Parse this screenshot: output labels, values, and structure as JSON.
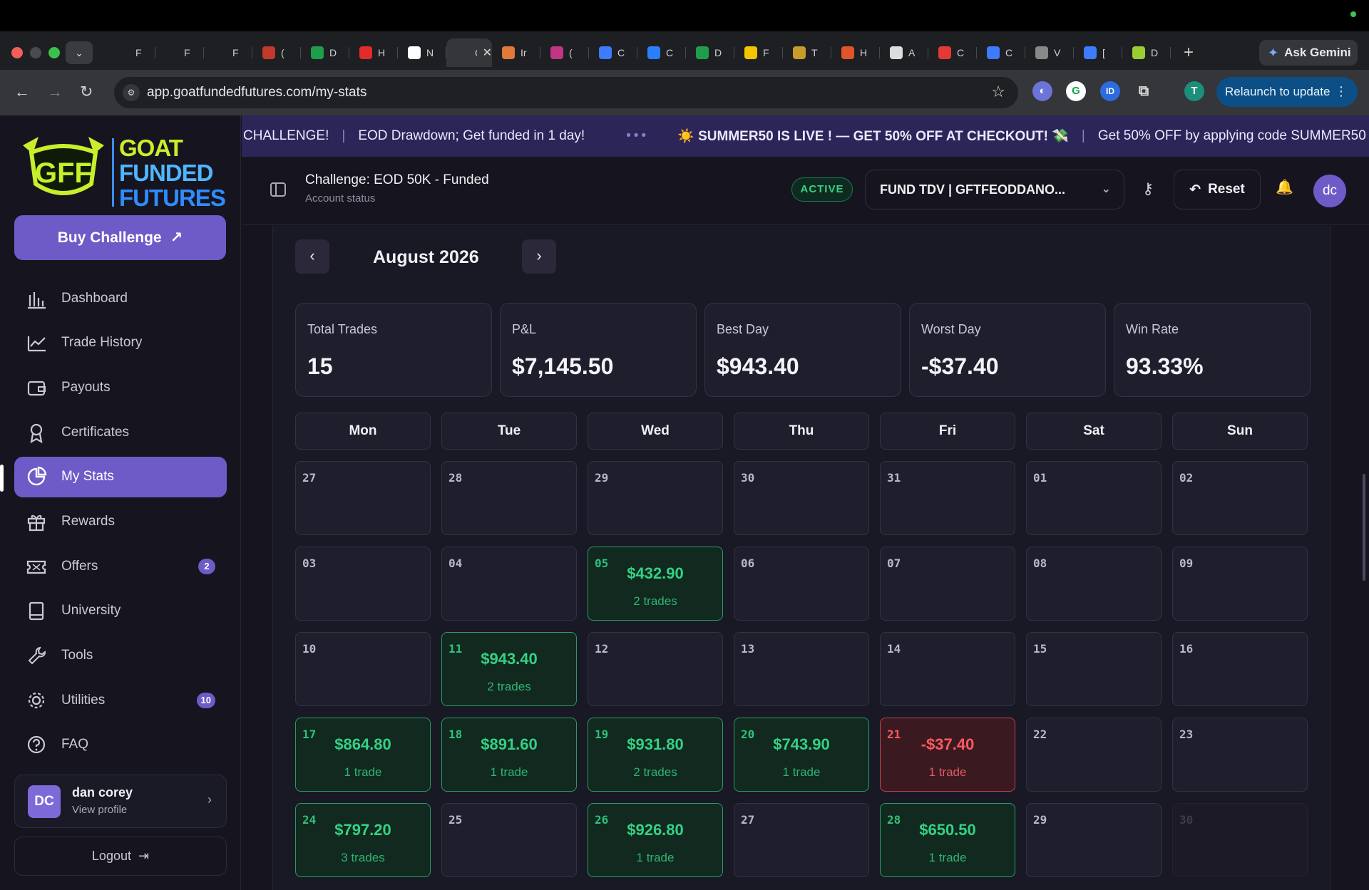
{
  "browser": {
    "tabs": [
      {
        "label": "F",
        "color": "#1e1f22"
      },
      {
        "label": "F",
        "color": "#1e1f22"
      },
      {
        "label": "F",
        "color": "#1e1f22"
      },
      {
        "label": "(",
        "color": "#c0392b"
      },
      {
        "label": "D",
        "color": "#1e9e4a"
      },
      {
        "label": "H",
        "color": "#e22b2b"
      },
      {
        "label": "N",
        "color": "#ffffff"
      },
      {
        "label": "G",
        "color": "#35363a",
        "active": true
      },
      {
        "label": "Ir",
        "color": "#e07a3a"
      },
      {
        "label": "(",
        "color": "#c13584"
      },
      {
        "label": "C",
        "color": "#3d7bff"
      },
      {
        "label": "C",
        "color": "#2a7fff"
      },
      {
        "label": "D",
        "color": "#1e9e4a"
      },
      {
        "label": "F",
        "color": "#f2c500"
      },
      {
        "label": "T",
        "color": "#c89b2a"
      },
      {
        "label": "H",
        "color": "#e2542b"
      },
      {
        "label": "A",
        "color": "#dddddd"
      },
      {
        "label": "C",
        "color": "#e53935"
      },
      {
        "label": "C",
        "color": "#3d7bff"
      },
      {
        "label": "V",
        "color": "#888888"
      },
      {
        "label": "[",
        "color": "#3d7bff"
      },
      {
        "label": "D",
        "color": "#9acd32"
      }
    ],
    "active_tab_close": "✕",
    "new_tab": "+",
    "gemini_label": "Ask Gemini",
    "url": "app.goatfundedfutures.com/my-stats",
    "relaunch_label": "Relaunch to update",
    "profile_initial": "T"
  },
  "sidebar": {
    "logo_lines": [
      "GOAT",
      "FUNDED",
      "FUTURES"
    ],
    "buy_label": "Buy Challenge",
    "nav": [
      {
        "label": "Dashboard",
        "icon": "bar-chart-icon"
      },
      {
        "label": "Trade History",
        "icon": "line-chart-icon"
      },
      {
        "label": "Payouts",
        "icon": "wallet-icon"
      },
      {
        "label": "Certificates",
        "icon": "award-icon"
      },
      {
        "label": "My Stats",
        "icon": "pie-chart-icon",
        "active": true
      },
      {
        "label": "Rewards",
        "icon": "gift-icon"
      },
      {
        "label": "Offers",
        "icon": "ticket-icon",
        "badge": "2"
      },
      {
        "label": "University",
        "icon": "book-icon"
      },
      {
        "label": "Tools",
        "icon": "wrench-icon"
      },
      {
        "label": "Utilities",
        "icon": "cog-icon",
        "badge": "10"
      },
      {
        "label": "FAQ",
        "icon": "help-circle-icon"
      }
    ],
    "profile": {
      "initials": "DC",
      "name": "dan corey",
      "link": "View profile"
    },
    "logout_label": "Logout"
  },
  "ticker": {
    "left_fragment": "CHALLENGE!",
    "msg1": "EOD Drawdown; Get funded in 1 day!",
    "msg2": "☀️ SUMMER50 IS LIVE ! — GET 50% OFF AT CHECKOUT! 💸",
    "msg3": "Get 50% OFF by applying code SUMMER50"
  },
  "header": {
    "title": "Challenge: EOD 50K - Funded",
    "subtitle": "Account status",
    "status": "ACTIVE",
    "account": "FUND TDV | GFTFEODDANO...",
    "reset_label": "Reset",
    "avatar": "dc"
  },
  "calendar": {
    "month": "August 2026",
    "stats": [
      {
        "label": "Total Trades",
        "value": "15"
      },
      {
        "label": "P&L",
        "value": "$7,145.50"
      },
      {
        "label": "Best Day",
        "value": "$943.40"
      },
      {
        "label": "Worst Day",
        "value": "-$37.40"
      },
      {
        "label": "Win Rate",
        "value": "93.33%"
      }
    ],
    "weekdays": [
      "Mon",
      "Tue",
      "Wed",
      "Thu",
      "Fri",
      "Sat",
      "Sun"
    ],
    "days": [
      {
        "day": "27"
      },
      {
        "day": "28"
      },
      {
        "day": "29"
      },
      {
        "day": "30"
      },
      {
        "day": "31"
      },
      {
        "day": "01"
      },
      {
        "day": "02"
      },
      {
        "day": "03"
      },
      {
        "day": "04"
      },
      {
        "day": "05",
        "pnl": "$432.90",
        "trades": "2 trades",
        "type": "gain"
      },
      {
        "day": "06"
      },
      {
        "day": "07"
      },
      {
        "day": "08"
      },
      {
        "day": "09"
      },
      {
        "day": "10"
      },
      {
        "day": "11",
        "pnl": "$943.40",
        "trades": "2 trades",
        "type": "gain"
      },
      {
        "day": "12"
      },
      {
        "day": "13"
      },
      {
        "day": "14"
      },
      {
        "day": "15"
      },
      {
        "day": "16"
      },
      {
        "day": "17",
        "pnl": "$864.80",
        "trades": "1 trade",
        "type": "gain"
      },
      {
        "day": "18",
        "pnl": "$891.60",
        "trades": "1 trade",
        "type": "gain"
      },
      {
        "day": "19",
        "pnl": "$931.80",
        "trades": "2 trades",
        "type": "gain"
      },
      {
        "day": "20",
        "pnl": "$743.90",
        "trades": "1 trade",
        "type": "gain"
      },
      {
        "day": "21",
        "pnl": "-$37.40",
        "trades": "1 trade",
        "type": "loss"
      },
      {
        "day": "22"
      },
      {
        "day": "23"
      },
      {
        "day": "24",
        "pnl": "$797.20",
        "trades": "3 trades",
        "type": "gain"
      },
      {
        "day": "25"
      },
      {
        "day": "26",
        "pnl": "$926.80",
        "trades": "1 trade",
        "type": "gain"
      },
      {
        "day": "27"
      },
      {
        "day": "28",
        "pnl": "$650.50",
        "trades": "1 trade",
        "type": "gain"
      },
      {
        "day": "29"
      },
      {
        "day": "30",
        "type": "faded"
      }
    ]
  }
}
